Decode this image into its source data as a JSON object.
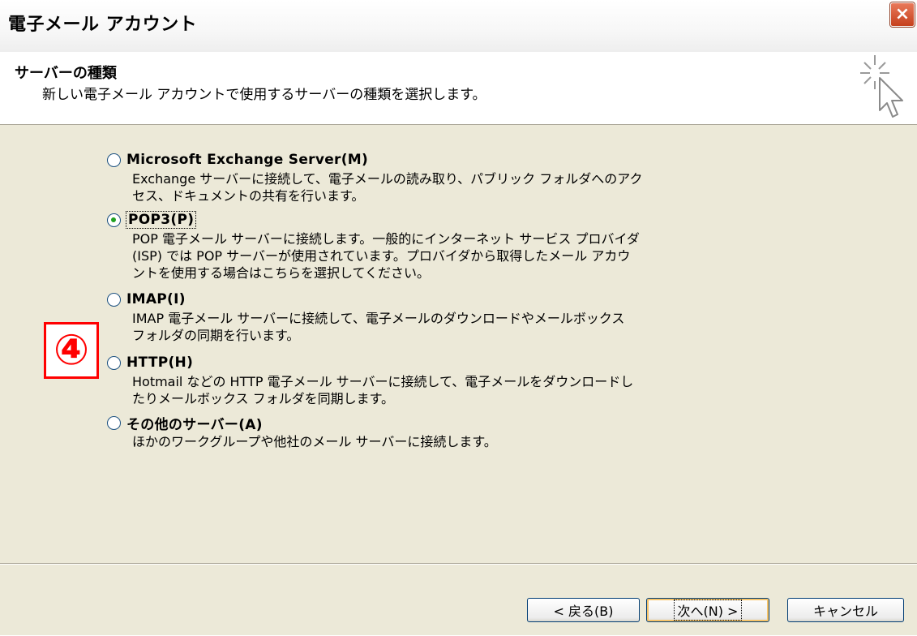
{
  "window": {
    "title": "電子メール アカウント",
    "close_label": "×"
  },
  "header": {
    "title": "サーバーの種類",
    "subtitle": "新しい電子メール アカウントで使用するサーバーの種類を選択します。"
  },
  "step_badge": "④",
  "options": [
    {
      "label": "Microsoft Exchange Server(M)",
      "description": "Exchange サーバーに接続して、電子メールの読み取り、パブリック フォルダへのアク\nセス、ドキュメントの共有を行います。",
      "selected": false
    },
    {
      "label": "POP3(P)",
      "description": "POP 電子メール サーバーに接続します。一般的にインターネット サービス プロバイダ\n(ISP) では POP サーバーが使用されています。プロバイダから取得したメール アカウ\nントを使用する場合はこちらを選択してください。",
      "selected": true
    },
    {
      "label": "IMAP(I)",
      "description": "IMAP 電子メール サーバーに接続して、電子メールのダウンロードやメールボックス\nフォルダの同期を行います。",
      "selected": false
    },
    {
      "label": "HTTP(H)",
      "description": "Hotmail などの HTTP 電子メール サーバーに接続して、電子メールをダウンロードし\nたりメールボックス フォルダを同期します。",
      "selected": false
    },
    {
      "label": "その他のサーバー(A)",
      "description": "ほかのワークグループや他社のメール サーバーに接続します。",
      "selected": false
    }
  ],
  "buttons": {
    "back": "< 戻る(B)",
    "next": "次へ(N) >",
    "cancel": "キャンセル"
  },
  "colors": {
    "badge": "#ff0000",
    "selected_radio_dot": "#21a121",
    "dialog_background": "#ece9d8"
  }
}
